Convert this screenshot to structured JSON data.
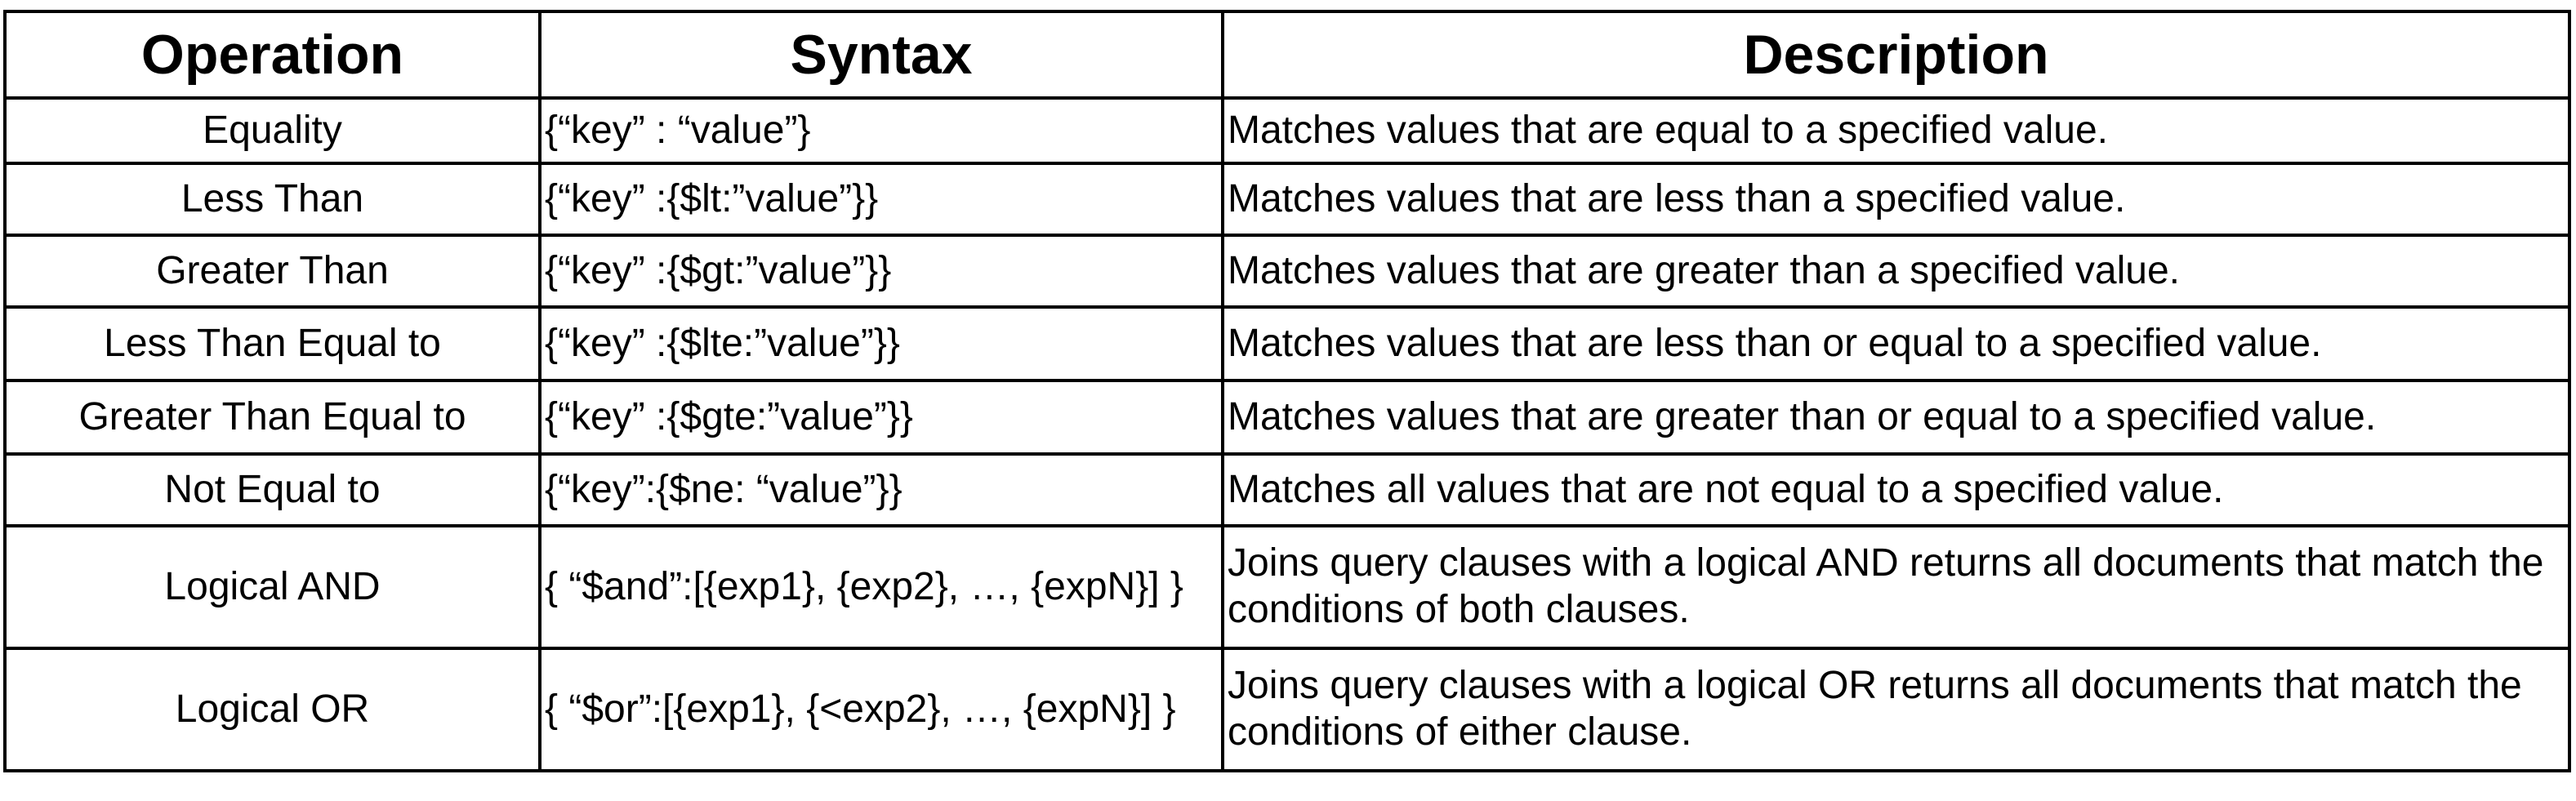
{
  "table": {
    "headers": {
      "operation": "Operation",
      "syntax": "Syntax",
      "description": "Description"
    },
    "rows": [
      {
        "operation": "Equality",
        "syntax": "{“key” : “value”}",
        "description": "Matches values that are equal to a specified value."
      },
      {
        "operation": "Less Than",
        "syntax": "{“key” :{$lt:”value”}}",
        "description": "Matches values that are less than a specified value."
      },
      {
        "operation": "Greater Than",
        "syntax": "{“key” :{$gt:”value”}}",
        "description": "Matches values that are greater than a specified value."
      },
      {
        "operation": "Less Than Equal to",
        "syntax": "{“key” :{$lte:”value”}}",
        "description": "Matches values that are less than or equal to a specified value."
      },
      {
        "operation": "Greater Than Equal to",
        "syntax": "{“key” :{$gte:”value”}}",
        "description": "Matches values that are greater than or equal to a specified value."
      },
      {
        "operation": "Not Equal to",
        "syntax": "{“key”:{$ne: “value”}}",
        "description": "Matches all values that are not equal to a specified value."
      },
      {
        "operation": "Logical AND",
        "syntax": "{ “$and”:[{exp1}, {exp2}, …, {expN}] }",
        "description": "Joins query clauses with a logical AND returns all documents that match the conditions of both clauses."
      },
      {
        "operation": "Logical OR",
        "syntax": "{ “$or”:[{exp1}, {<exp2}, …, {expN}] }",
        "description": "Joins query clauses with a logical OR returns all documents that match the conditions of either clause."
      }
    ]
  }
}
